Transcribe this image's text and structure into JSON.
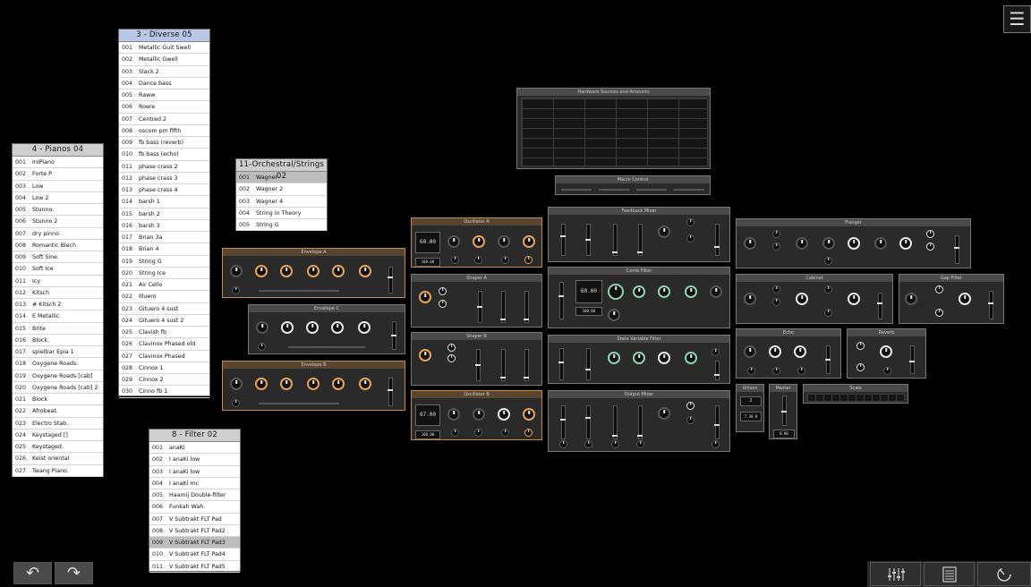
{
  "lists": {
    "pianos": {
      "title": "4 - Pianos 04",
      "items": [
        [
          "001",
          "InIPiano"
        ],
        [
          "002",
          "Forte P"
        ],
        [
          "003",
          "Low"
        ],
        [
          "004",
          "Low 2"
        ],
        [
          "005",
          "Stunno."
        ],
        [
          "006",
          "Stunno 2"
        ],
        [
          "007",
          "dry pinno"
        ],
        [
          "008",
          "Romantic Blech"
        ],
        [
          "009",
          "Soft Sine."
        ],
        [
          "010",
          "Soft Ice"
        ],
        [
          "011",
          "Icy"
        ],
        [
          "012",
          "Kitsch"
        ],
        [
          "013",
          "# Kitsch 2"
        ],
        [
          "014",
          "E Metallic"
        ],
        [
          "015",
          "Brite"
        ],
        [
          "016",
          "Block."
        ],
        [
          "017",
          "spielbar Epia 1"
        ],
        [
          "018",
          "Oxygene Roads."
        ],
        [
          "019",
          "Oxygene Roads [cab]"
        ],
        [
          "020",
          "Oxygene Roads [cab] 2"
        ],
        [
          "021",
          "Block"
        ],
        [
          "022",
          "Afrobeat."
        ],
        [
          "023",
          "Electro Stab."
        ],
        [
          "024",
          "Keystaged []"
        ],
        [
          "025",
          "Keystaged."
        ],
        [
          "026",
          "Keist oriental"
        ],
        [
          "027",
          "Twang Piano."
        ]
      ]
    },
    "diverse": {
      "title": "3 - Diverse 05",
      "items": [
        [
          "001",
          "Metallic Guit Swell"
        ],
        [
          "002",
          "Metallic Gwell"
        ],
        [
          "003",
          "Slack 2"
        ],
        [
          "004",
          "Dance bass"
        ],
        [
          "005",
          "Raww"
        ],
        [
          "006",
          "Roere"
        ],
        [
          "007",
          "Centred 2"
        ],
        [
          "008",
          "oscom pm fifth"
        ],
        [
          "009",
          "fb bass (reverb)"
        ],
        [
          "010",
          "fb bass (echo)"
        ],
        [
          "011",
          "phase crass 2"
        ],
        [
          "012",
          "phase crass 3"
        ],
        [
          "013",
          "phase crass 4"
        ],
        [
          "014",
          "barsh 1"
        ],
        [
          "015",
          "barsh 2"
        ],
        [
          "016",
          "barsh 3"
        ],
        [
          "017",
          "Brian 3a"
        ],
        [
          "018",
          "Brian 4"
        ],
        [
          "019",
          "String G"
        ],
        [
          "020",
          "String Ice"
        ],
        [
          "021",
          "Air Cello"
        ],
        [
          "022",
          "Illuero"
        ],
        [
          "023",
          "Gituero 4 sust"
        ],
        [
          "024",
          "Gituero 4 sust 2"
        ],
        [
          "025",
          "Clavish fb"
        ],
        [
          "026",
          "Clavinox Phased old"
        ],
        [
          "027",
          "Clavinox Phased"
        ],
        [
          "028",
          "Cinnox 1"
        ],
        [
          "029",
          "Cinnox 2"
        ],
        [
          "030",
          "Cinno fb 1"
        ]
      ]
    },
    "strings": {
      "title": "11-Orchestral/Strings 02",
      "items": [
        [
          "001",
          "Wagner"
        ],
        [
          "002",
          "Wagner 2"
        ],
        [
          "003",
          "Wagner 4"
        ],
        [
          "004",
          "String in Theory"
        ],
        [
          "005",
          "String G"
        ]
      ],
      "selected_index": 0
    },
    "filter": {
      "title": "8 - Filter 02",
      "items": [
        [
          "001",
          "anaKi"
        ],
        [
          "002",
          "I anaKi low"
        ],
        [
          "003",
          "I anaKi low"
        ],
        [
          "004",
          "I anaKi mc"
        ],
        [
          "005",
          "Haamij Double-filter"
        ],
        [
          "006",
          "Funkah Wah."
        ],
        [
          "007",
          "V Subtrakt FLT Pad"
        ],
        [
          "008",
          "V Subtrakt FLT Pad2"
        ],
        [
          "009",
          "V Subtrakt FLT Pad3"
        ],
        [
          "010",
          "V Subtrakt FLT Pad4"
        ],
        [
          "011",
          "V Subtrakt FLT Pad5"
        ]
      ],
      "selected_index": 8
    }
  },
  "modules": {
    "hw_sources": "Hardware Sources and Amounts",
    "macro": "Macro Control",
    "feedback_mixer": "Feedback Mixer",
    "flanger": "Flanger",
    "osc_a": "Oscillator A",
    "osc_a_value": "60.00",
    "osc_a_sub": "100.00",
    "shaper_a": "Shaper A",
    "shaper_b": "Shaper B",
    "osc_b": "Oscillator B",
    "osc_b_value": "67.00",
    "osc_b_sub": "100.00",
    "comb": "Comb Filter",
    "comb_value": "60.00",
    "comb_sub": "100.00",
    "svf": "State Variable Filter",
    "output_mixer": "Output Mixer",
    "cabinet": "Cabinet",
    "gap_filter": "Gap Filter",
    "echo": "Echo",
    "reverb": "Reverb",
    "unison": "Unison",
    "unison_value": "2",
    "unison_sub": "7.30 0",
    "master": "Master",
    "master_value": "0.00",
    "scale": "Scale",
    "env_a": "Envelope A",
    "env_b": "Envelope B",
    "env_c": "Envelope C"
  },
  "toolbar": {
    "undo_icon": "↶",
    "redo_icon": "↷",
    "menu_icon": "☰"
  },
  "colors": {
    "accent_orange": "#e9a45a",
    "accent_green": "#8fd4b5",
    "list_title_blue": "#b9c7e6"
  }
}
